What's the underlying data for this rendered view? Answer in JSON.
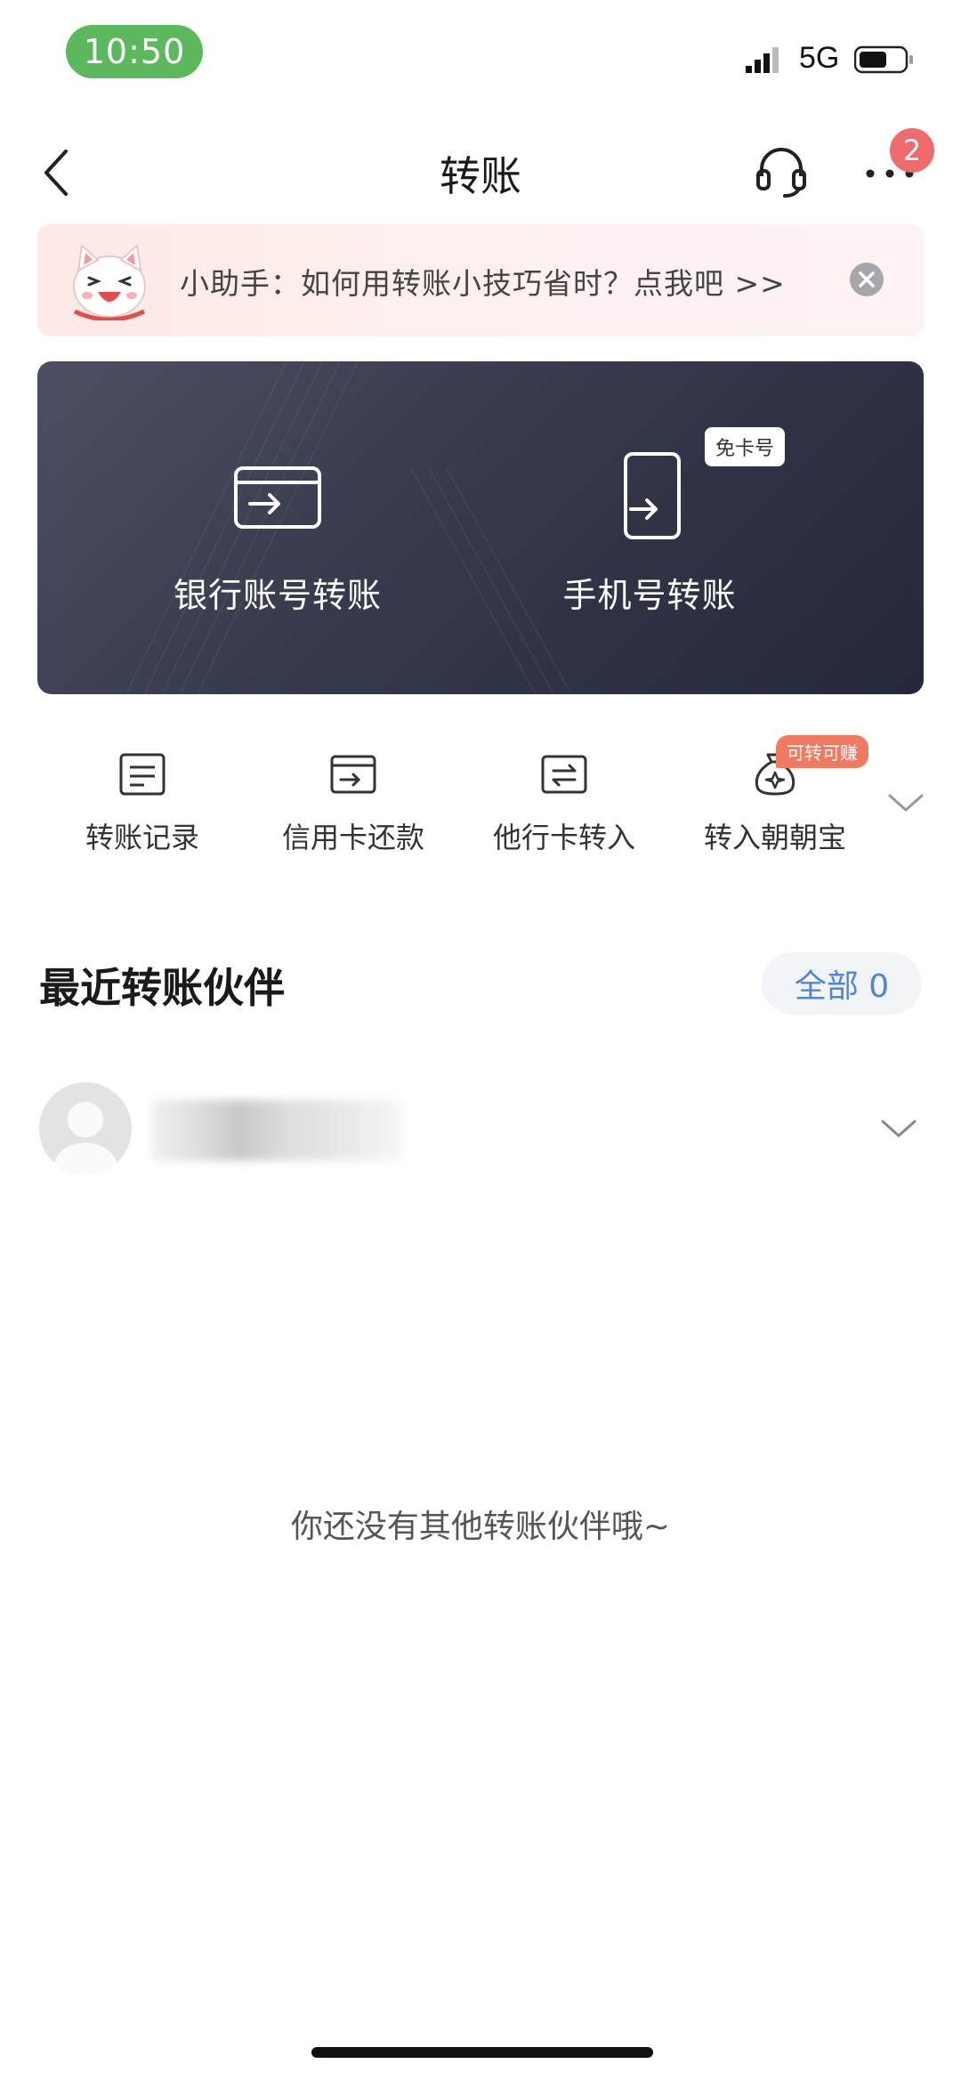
{
  "status_bar": {
    "time": "10:50",
    "network": "5G",
    "signal_icon": "signal-icon",
    "battery_icon": "battery-icon"
  },
  "nav": {
    "back_icon": "chevron-left-icon",
    "title": "转账",
    "service_icon": "headset-icon",
    "more_icon": "more-dots-icon",
    "badge_count": "2"
  },
  "assistant": {
    "mascot_icon": "cat-mascot-icon",
    "text": "小助手：如何用转账小技巧省时？点我吧 >>",
    "close_icon": "close-circle-icon"
  },
  "transfer_card": {
    "bank": {
      "label": "银行账号转账",
      "icon": "bank-card-icon"
    },
    "phone": {
      "label": "手机号转账",
      "icon": "phone-transfer-icon",
      "tag": "免卡号"
    }
  },
  "quick_actions": [
    {
      "label": "转账记录",
      "icon": "document-icon"
    },
    {
      "label": "信用卡还款",
      "icon": "credit-card-icon"
    },
    {
      "label": "他行卡转入",
      "icon": "card-swap-icon"
    },
    {
      "label": "转入朝朝宝",
      "icon": "money-bag-icon",
      "badge": "可转可赚"
    }
  ],
  "expand_icon": "chevron-down-icon",
  "recent": {
    "title": "最近转账伙伴",
    "all_label": "全部 0",
    "empty_text": "你还没有其他转账伙伴哦~"
  },
  "colors": {
    "status_pill": "#5cb85c",
    "badge": "#f06b6b",
    "card_dark": "#2c2f40",
    "link_blue": "#4d86d6",
    "earn_badge": "#ef7a5f"
  }
}
